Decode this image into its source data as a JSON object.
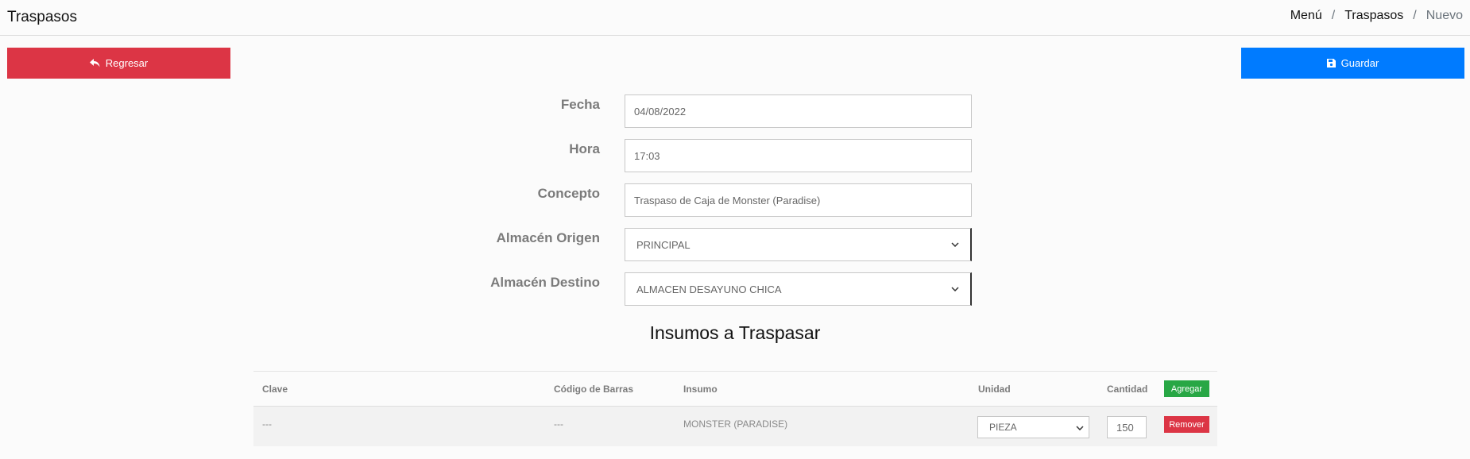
{
  "header": {
    "title": "Traspasos",
    "breadcrumb": [
      {
        "label": "Menú"
      },
      {
        "label": "Traspasos"
      },
      {
        "label": "Nuevo"
      }
    ]
  },
  "actions": {
    "back_label": "Regresar",
    "save_label": "Guardar"
  },
  "form": {
    "fecha_label": "Fecha",
    "fecha_value": "04/08/2022",
    "hora_label": "Hora",
    "hora_value": "17:03",
    "concepto_label": "Concepto",
    "concepto_value": "Traspaso de Caja de Monster (Paradise)",
    "origen_label": "Almacén Origen",
    "origen_value": "PRINCIPAL",
    "destino_label": "Almacén Destino",
    "destino_value": "ALMACEN DESAYUNO CHICA"
  },
  "section": {
    "title": "Insumos a Traspasar"
  },
  "table": {
    "columns": {
      "clave": "Clave",
      "codigo": "Código de Barras",
      "insumo": "Insumo",
      "unidad": "Unidad",
      "cantidad": "Cantidad"
    },
    "add_label": "Agregar",
    "rows": [
      {
        "clave": "---",
        "codigo": "---",
        "insumo": "MONSTER (PARADISE)",
        "unidad": "PIEZA",
        "cantidad": "150",
        "remove_label": "Remover"
      }
    ]
  },
  "colors": {
    "danger": "#dc3545",
    "primary": "#007bff",
    "success": "#28a745"
  },
  "icons": {
    "back": "reply-icon",
    "save": "floppy-disk-icon",
    "select": "chevron-down-icon"
  }
}
